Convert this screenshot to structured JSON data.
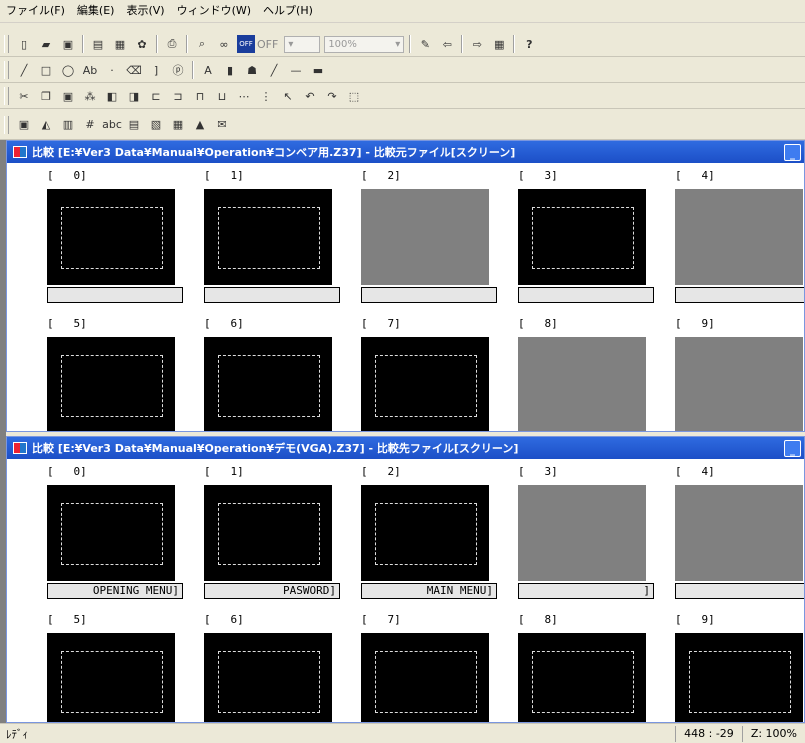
{
  "menu": [
    "ファイル(F)",
    "編集(E)",
    "表示(V)",
    "ウィンドウ(W)",
    "ヘルプ(H)"
  ],
  "toolbar": {
    "off_label": "OFF",
    "zoom_value": "100%",
    "help_label": "?"
  },
  "window1": {
    "title": "比較 [E:¥Ver3 Data¥Manual¥Operation¥コンベア用.Z37] - 比較元ファイル[スクリーン]",
    "screens": [
      {
        "index": "[   0]",
        "name": "",
        "empty": false
      },
      {
        "index": "[   1]",
        "name": "",
        "empty": false
      },
      {
        "index": "[   2]",
        "name": "",
        "empty": true
      },
      {
        "index": "[   3]",
        "name": "",
        "empty": false
      },
      {
        "index": "[   4]",
        "name": "",
        "empty": true
      },
      {
        "index": "[   5]",
        "name": "",
        "empty": false
      },
      {
        "index": "[   6]",
        "name": "",
        "empty": false
      },
      {
        "index": "[   7]",
        "name": "",
        "empty": false
      },
      {
        "index": "[   8]",
        "name": "",
        "empty": true
      },
      {
        "index": "[   9]",
        "name": "",
        "empty": true
      }
    ]
  },
  "window2": {
    "title": "比較 [E:¥Ver3 Data¥Manual¥Operation¥デモ(VGA).Z37] - 比較先ファイル[スクリーン]",
    "screens": [
      {
        "index": "[   0]",
        "name": "OPENING MENU]",
        "empty": false
      },
      {
        "index": "[   1]",
        "name": "PASWORD]",
        "empty": false
      },
      {
        "index": "[   2]",
        "name": "MAIN MENU]",
        "empty": false
      },
      {
        "index": "[   3]",
        "name": "]",
        "empty": true
      },
      {
        "index": "[   4]",
        "name": "",
        "empty": true
      },
      {
        "index": "[   5]",
        "name": "",
        "empty": false
      },
      {
        "index": "[   6]",
        "name": "",
        "empty": false
      },
      {
        "index": "[   7]",
        "name": "",
        "empty": false
      },
      {
        "index": "[   8]",
        "name": "",
        "empty": false
      },
      {
        "index": "[   9]",
        "name": "",
        "empty": false
      }
    ]
  },
  "status": {
    "ready": "ﾚﾃﾞｨ",
    "coords": "448 : -29",
    "zoom": "Z: 100%"
  },
  "colors": {
    "titlebar": "#2f6be0",
    "thumb_empty": "#808080",
    "thumb_bg": "#000000"
  }
}
